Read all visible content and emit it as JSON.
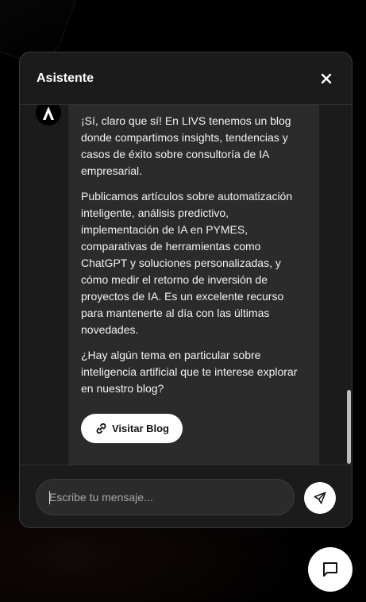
{
  "header": {
    "title": "Asistente",
    "close_icon": "close-icon"
  },
  "bot": {
    "avatar_icon": "livs-logo-icon"
  },
  "message": {
    "paragraphs": [
      "¡Sí, claro que sí! En LIVS tenemos un blog donde compartimos insights, tendencias y casos de éxito sobre consultoría de IA empresarial.",
      "Publicamos artículos sobre automatización inteligente, análisis predictivo, implementación de IA en PYMES, comparativas de herramientas como ChatGPT y soluciones personalizadas, y cómo medir el retorno de inversión de proyectos de IA. Es un excelente recurso para mantenerte al día con las últimas novedades.",
      "¿Hay algún tema en particular sobre inteligencia artificial que te interese explorar en nuestro blog?"
    ],
    "action_button": {
      "label": "Visitar Blog",
      "icon": "link-icon"
    }
  },
  "composer": {
    "placeholder": "Escribe tu mensaje...",
    "value": "",
    "send_icon": "send-icon"
  },
  "launcher": {
    "icon": "chat-bubble-icon"
  },
  "colors": {
    "background": "#000000",
    "panel": "#1b1b1b",
    "bubble": "#2b2b2b",
    "accent": "#ffffff"
  }
}
